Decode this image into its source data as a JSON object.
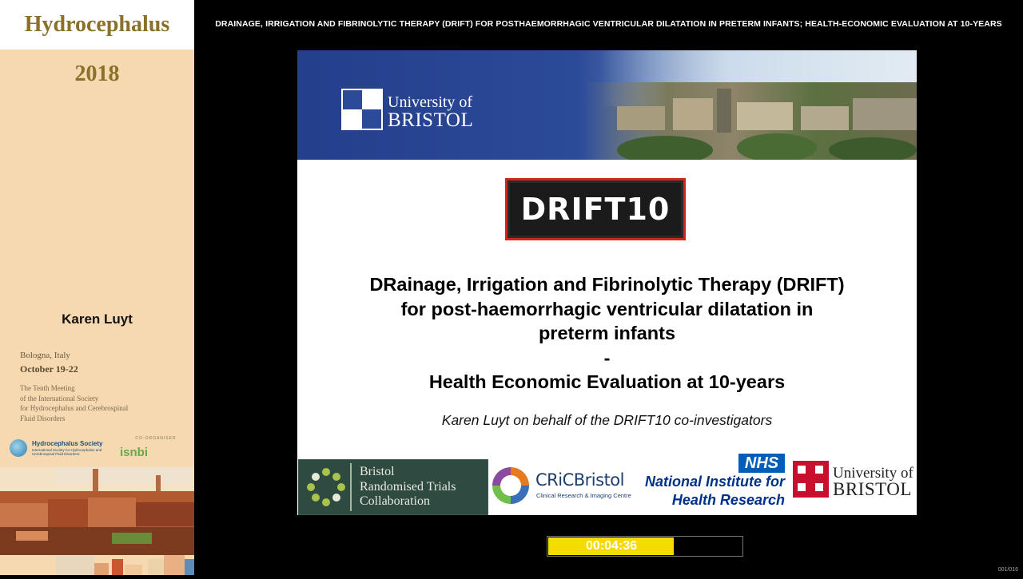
{
  "conference": {
    "title": "Hydrocephalus 2018",
    "speaker": "Karen Luyt",
    "place": "Bologna, Italy",
    "dates": "October 19-22",
    "meeting_lines": [
      "The Tenth Meeting",
      "of the International Society",
      "for Hydrocephalus and Cerebrospinal",
      "Fluid Disorders"
    ],
    "society_name": "Hydrocephalus Society",
    "society_sub": "International Society for Hydrocephalus and Cerebrospinal Fluid Disorders",
    "coorganiser_label": "CO-ORGANISER",
    "coorganiser_name": "isnbi"
  },
  "topbar": {
    "title": "DRAINAGE, IRRIGATION AND FIBRINOLYTIC THERAPY (DRIFT) FOR POSTHAEMORRHAGIC VENTRICULAR DILATATION IN PRETERM INFANTS; HEALTH-ECONOMIC EVALUATION AT 10-YEARS"
  },
  "slide": {
    "uni_line1": "University of",
    "uni_line2": "BRISTOL",
    "drift_logo": "DRIFT10",
    "title_lines": [
      "DRainage, Irrigation and Fibrinolytic Therapy (DRIFT)",
      "for post-haemorrhagic ventricular dilatation in",
      "preterm infants",
      "-",
      "Health Economic Evaluation at 10-years"
    ],
    "author": "Karen Luyt on behalf of the DRIFT10 co-investigators",
    "footer": {
      "brtc_lines": [
        "Bristol",
        "Randomised Trials",
        "Collaboration"
      ],
      "cric_name": "CRiCBristol",
      "cric_sub": "Clinical Research & Imaging Centre",
      "nhs": "NHS",
      "nihr_line1": "National Institute for",
      "nihr_line2": "Health Research",
      "uob_line1": "University of",
      "uob_line2": "BRISTOL"
    }
  },
  "player": {
    "time": "00:04:36",
    "progress": 0.65,
    "slide_counter": "001/016"
  },
  "colors": {
    "sidebar_bg": "#f6d9b0",
    "title_gold": "#8a7028",
    "banner_blue": "#2b4a98",
    "drift_red": "#d0241f",
    "timer_yellow": "#f5dc00"
  }
}
